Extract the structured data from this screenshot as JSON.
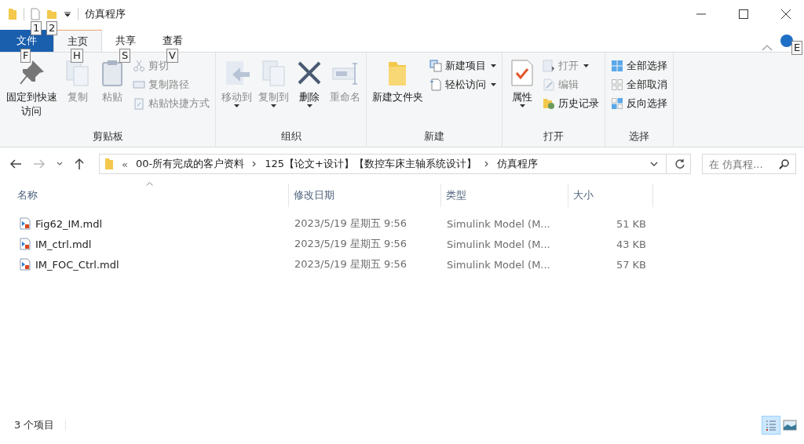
{
  "window": {
    "title": "仿真程序"
  },
  "quick_access": [
    {
      "keytip": "1"
    },
    {
      "keytip": "2"
    }
  ],
  "tabs": [
    {
      "label": "文件",
      "kind": "file",
      "keytip": "F",
      "selected": false
    },
    {
      "label": "主页",
      "kind": "tab",
      "keytip": "H",
      "selected": true
    },
    {
      "label": "共享",
      "kind": "tab",
      "keytip": "S",
      "selected": false
    },
    {
      "label": "查看",
      "kind": "tab",
      "keytip": "V",
      "selected": false
    }
  ],
  "help_keytip": "E",
  "ribbon": [
    {
      "label": "剪贴板",
      "items": [
        {
          "label": "固定到快速访问",
          "kind": "large",
          "disabled": false
        },
        {
          "label": "复制",
          "kind": "large",
          "disabled": true
        },
        {
          "label": "粘贴",
          "kind": "large",
          "disabled": true
        },
        {
          "kind": "stack",
          "items": [
            {
              "label": "剪切",
              "disabled": true,
              "dropdown": false
            },
            {
              "label": "复制路径",
              "disabled": true,
              "dropdown": false
            },
            {
              "label": "粘贴快捷方式",
              "disabled": true,
              "dropdown": false
            }
          ]
        }
      ]
    },
    {
      "label": "组织",
      "items": [
        {
          "label": "移动到",
          "kind": "large",
          "disabled": true,
          "dropdown": true
        },
        {
          "label": "复制到",
          "kind": "large",
          "disabled": true,
          "dropdown": true
        },
        {
          "label": "删除",
          "kind": "large",
          "disabled": false,
          "dropdown": true
        },
        {
          "label": "重命名",
          "kind": "large",
          "disabled": true
        }
      ]
    },
    {
      "label": "新建",
      "items": [
        {
          "label": "新建文件夹",
          "kind": "large",
          "disabled": false
        },
        {
          "kind": "stack",
          "items": [
            {
              "label": "新建项目",
              "disabled": false,
              "dropdown": true
            },
            {
              "label": "轻松访问",
              "disabled": false,
              "dropdown": true
            }
          ]
        }
      ]
    },
    {
      "label": "打开",
      "items": [
        {
          "label": "属性",
          "kind": "large",
          "disabled": false,
          "dropdown": true
        },
        {
          "kind": "stack",
          "items": [
            {
              "label": "打开",
              "disabled": true,
              "dropdown": true
            },
            {
              "label": "编辑",
              "disabled": true,
              "dropdown": false
            },
            {
              "label": "历史记录",
              "disabled": false,
              "dropdown": false
            }
          ]
        }
      ]
    },
    {
      "label": "选择",
      "items": [
        {
          "kind": "stack",
          "items": [
            {
              "label": "全部选择",
              "disabled": false,
              "dropdown": false
            },
            {
              "label": "全部取消",
              "disabled": false,
              "dropdown": false
            },
            {
              "label": "反向选择",
              "disabled": false,
              "dropdown": false
            }
          ]
        }
      ]
    }
  ],
  "address": {
    "overflow": "«",
    "path": [
      "00-所有完成的客户资料",
      "125【论文+设计】【数控车床主轴系统设计】",
      "仿真程序"
    ]
  },
  "search": {
    "placeholder": "在 仿真程..."
  },
  "table": {
    "columns": [
      "名称",
      "修改日期",
      "类型",
      "大小"
    ],
    "rows": [
      {
        "name": "Fig62_IM.mdl",
        "modified": "2023/5/19 星期五 9:56",
        "type": "Simulink Model (M...",
        "size": "51 KB"
      },
      {
        "name": "IM_ctrl.mdl",
        "modified": "2023/5/19 星期五 9:56",
        "type": "Simulink Model (M...",
        "size": "43 KB"
      },
      {
        "name": "IM_FOC_Ctrl.mdl",
        "modified": "2023/5/19 星期五 9:56",
        "type": "Simulink Model (M...",
        "size": "57 KB"
      }
    ]
  },
  "status_bar": {
    "count": "3 个项目",
    "views": [
      {
        "kind": "details",
        "selected": true
      },
      {
        "kind": "thumbnails",
        "selected": false
      }
    ]
  }
}
